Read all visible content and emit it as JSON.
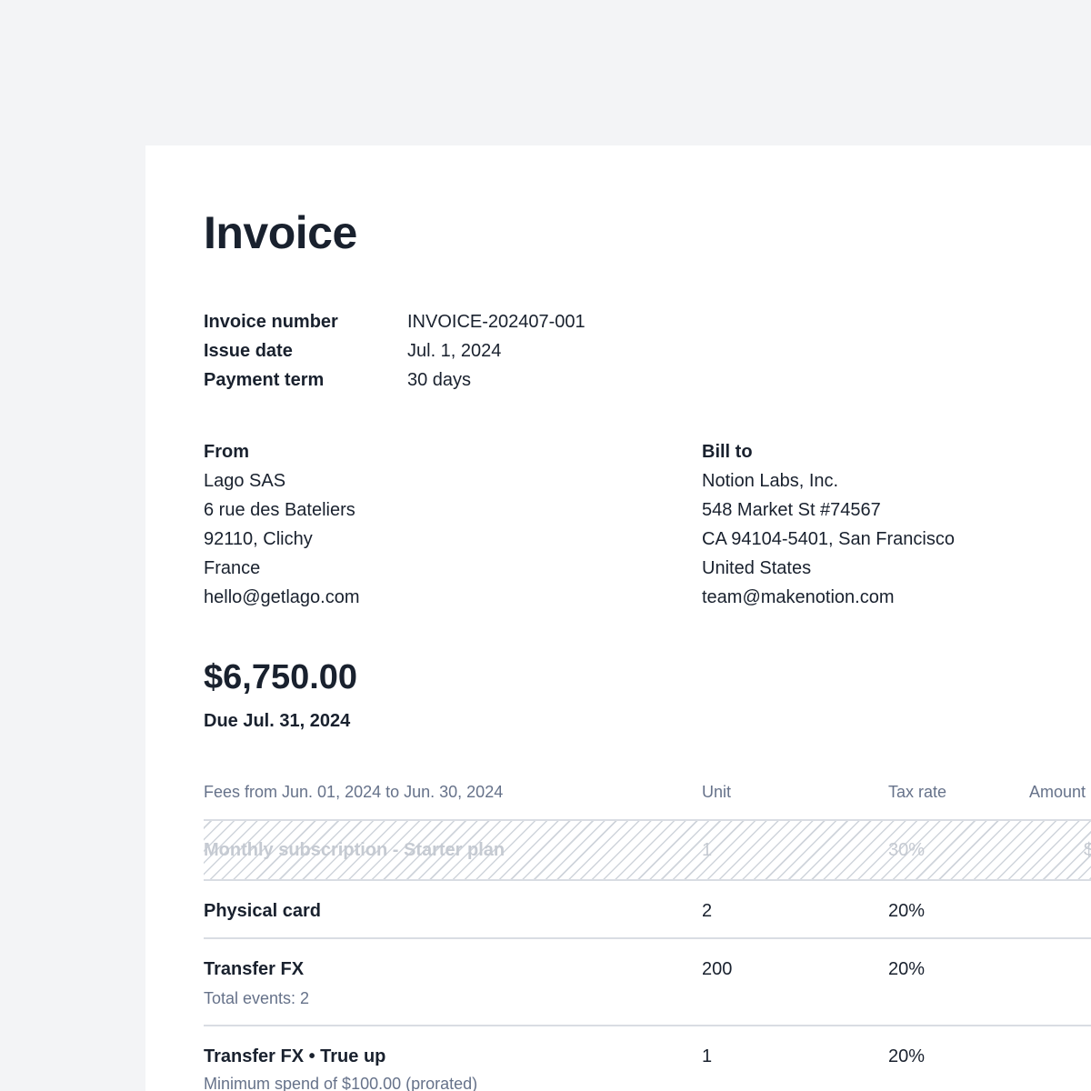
{
  "invoice": {
    "title": "Invoice",
    "meta": [
      {
        "label": "Invoice number",
        "value": "INVOICE-202407-001"
      },
      {
        "label": "Issue date",
        "value": "Jul. 1, 2024"
      },
      {
        "label": "Payment term",
        "value": "30 days"
      }
    ],
    "from": {
      "title": "From",
      "lines": [
        "Lago SAS",
        "6 rue des Bateliers",
        "92110, Clichy",
        "France",
        "hello@getlago.com"
      ]
    },
    "bill_to": {
      "title": "Bill to",
      "lines": [
        "Notion Labs, Inc.",
        "548 Market St #74567",
        "CA 94104-5401, San Francisco",
        "United States",
        "team@makenotion.com"
      ]
    },
    "total": "$6,750.00",
    "due": "Due Jul. 31, 2024",
    "table": {
      "headers": {
        "description": "Fees from Jun. 01, 2024 to Jun. 30, 2024",
        "unit": "Unit",
        "tax_rate": "Tax rate",
        "amount": "Amount"
      },
      "rows": [
        {
          "description": "Monthly subscription - Starter plan",
          "unit": "1",
          "tax_rate": "30%",
          "amount_fragment": "$",
          "state": "struck-out"
        },
        {
          "description": "Physical card",
          "unit": "2",
          "tax_rate": "20%"
        },
        {
          "description": "Transfer FX",
          "subtitle": "Total events: 2",
          "unit": "200",
          "tax_rate": "20%"
        },
        {
          "description": "Transfer FX • True up",
          "subtitle": "Minimum spend of $100.00 (prorated)",
          "unit": "1",
          "tax_rate": "20%"
        }
      ]
    }
  }
}
